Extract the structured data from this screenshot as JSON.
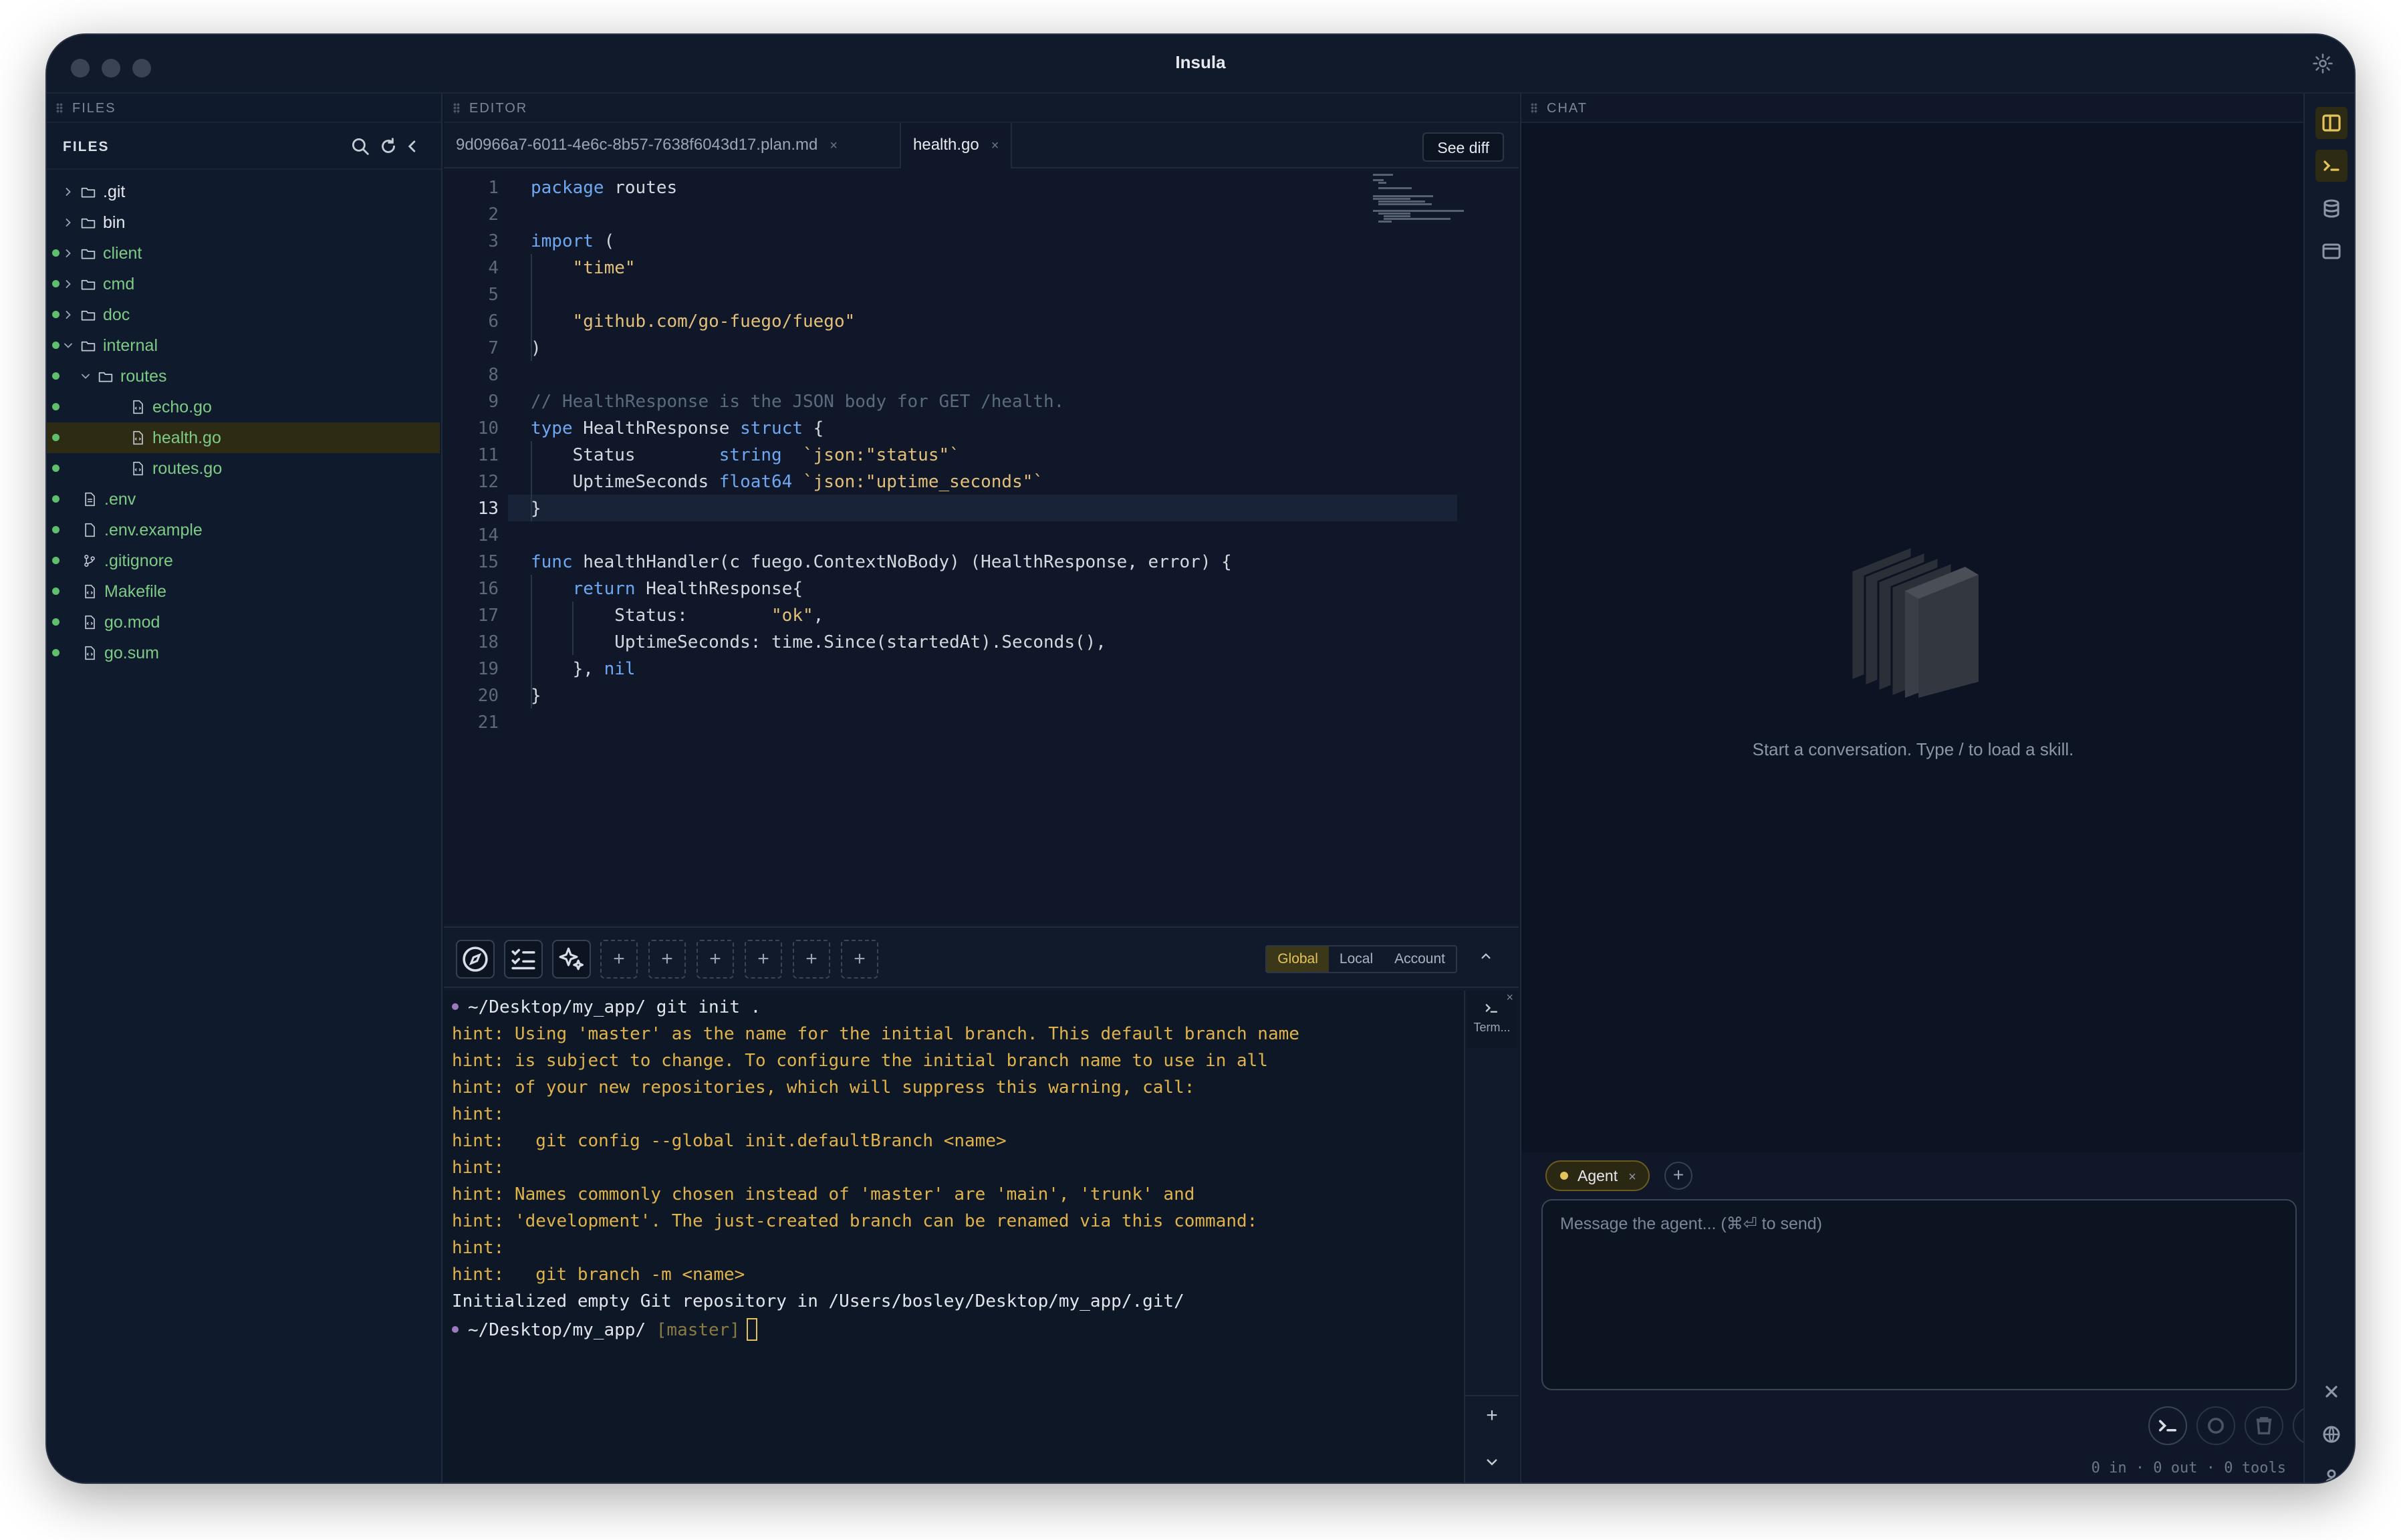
{
  "app": {
    "title": "Insula"
  },
  "files": {
    "panel_label": "FILES",
    "title": "FILES",
    "tree": [
      {
        "label": ".git",
        "type": "folder",
        "depth": 0,
        "expanded": false,
        "modified": false
      },
      {
        "label": "bin",
        "type": "folder",
        "depth": 0,
        "expanded": false,
        "modified": false
      },
      {
        "label": "client",
        "type": "folder",
        "depth": 0,
        "expanded": false,
        "modified": true
      },
      {
        "label": "cmd",
        "type": "folder",
        "depth": 0,
        "expanded": false,
        "modified": true
      },
      {
        "label": "doc",
        "type": "folder",
        "depth": 0,
        "expanded": false,
        "modified": true
      },
      {
        "label": "internal",
        "type": "folder",
        "depth": 0,
        "expanded": true,
        "modified": true
      },
      {
        "label": "routes",
        "type": "folder",
        "depth": 1,
        "expanded": true,
        "modified": true
      },
      {
        "label": "echo.go",
        "type": "code-file",
        "depth": 2,
        "modified": true
      },
      {
        "label": "health.go",
        "type": "code-file",
        "depth": 2,
        "modified": true,
        "selected": true
      },
      {
        "label": "routes.go",
        "type": "code-file",
        "depth": 2,
        "modified": true
      },
      {
        "label": ".env",
        "type": "text-file",
        "depth": 0,
        "modified": true
      },
      {
        "label": ".env.example",
        "type": "file",
        "depth": 0,
        "modified": true
      },
      {
        "label": ".gitignore",
        "type": "git-file",
        "depth": 0,
        "modified": true
      },
      {
        "label": "Makefile",
        "type": "code-file",
        "depth": 0,
        "modified": true
      },
      {
        "label": "go.mod",
        "type": "code-file",
        "depth": 0,
        "modified": true
      },
      {
        "label": "go.sum",
        "type": "code-file",
        "depth": 0,
        "modified": true
      }
    ]
  },
  "editor": {
    "panel_label": "EDITOR",
    "tabs": [
      {
        "label": "9d0966a7-6011-4e6c-8b57-7638f6043d17.plan.md",
        "active": false
      },
      {
        "label": "health.go",
        "active": true
      }
    ],
    "tab_close": "×",
    "see_diff_label": "See diff",
    "current_line": 13,
    "lines": [
      "package routes",
      "",
      "import (",
      "    \"time\"",
      "",
      "    \"github.com/go-fuego/fuego\"",
      ")",
      "",
      "// HealthResponse is the JSON body for GET /health.",
      "type HealthResponse struct {",
      "    Status        string  `json:\"status\"`",
      "    UptimeSeconds float64 `json:\"uptime_seconds\"`",
      "}",
      "",
      "func healthHandler(c fuego.ContextNoBody) (HealthResponse, error) {",
      "    return HealthResponse{",
      "        Status:        \"ok\",",
      "        UptimeSeconds: time.Since(startedAt).Seconds(),",
      "    }, nil",
      "}",
      ""
    ]
  },
  "toolbar": {
    "scopes": [
      "Global",
      "Local",
      "Account"
    ],
    "active_scope": "Global",
    "add_slot": "+"
  },
  "terminal": {
    "tab_label": "Term...",
    "prompt_1": "~/Desktop/my_app/ git init .",
    "output": [
      "hint: Using 'master' as the name for the initial branch. This default branch name",
      "hint: is subject to change. To configure the initial branch name to use in all",
      "hint: of your new repositories, which will suppress this warning, call:",
      "hint:",
      "hint:   git config --global init.defaultBranch <name>",
      "hint:",
      "hint: Names commonly chosen instead of 'master' are 'main', 'trunk' and",
      "hint: 'development'. The just-created branch can be renamed via this command:",
      "hint:",
      "hint:   git branch -m <name>"
    ],
    "result": "Initialized empty Git repository in /Users/bosley/Desktop/my_app/.git/",
    "prompt_2_path": "~/Desktop/my_app/",
    "prompt_2_branch": "[master]"
  },
  "chat": {
    "panel_label": "CHAT",
    "empty_text": "Start a conversation. Type / to load a skill.",
    "agent_label": "Agent",
    "agent_close": "×",
    "add_label": "+",
    "placeholder": "Message the agent... (⌘⏎ to send)",
    "stats": "0 in · 0 out · 0 tools"
  },
  "colors": {
    "accent": "#e5c35b",
    "modified_dot": "#5fbf6a",
    "hint": "#e0b24a"
  }
}
